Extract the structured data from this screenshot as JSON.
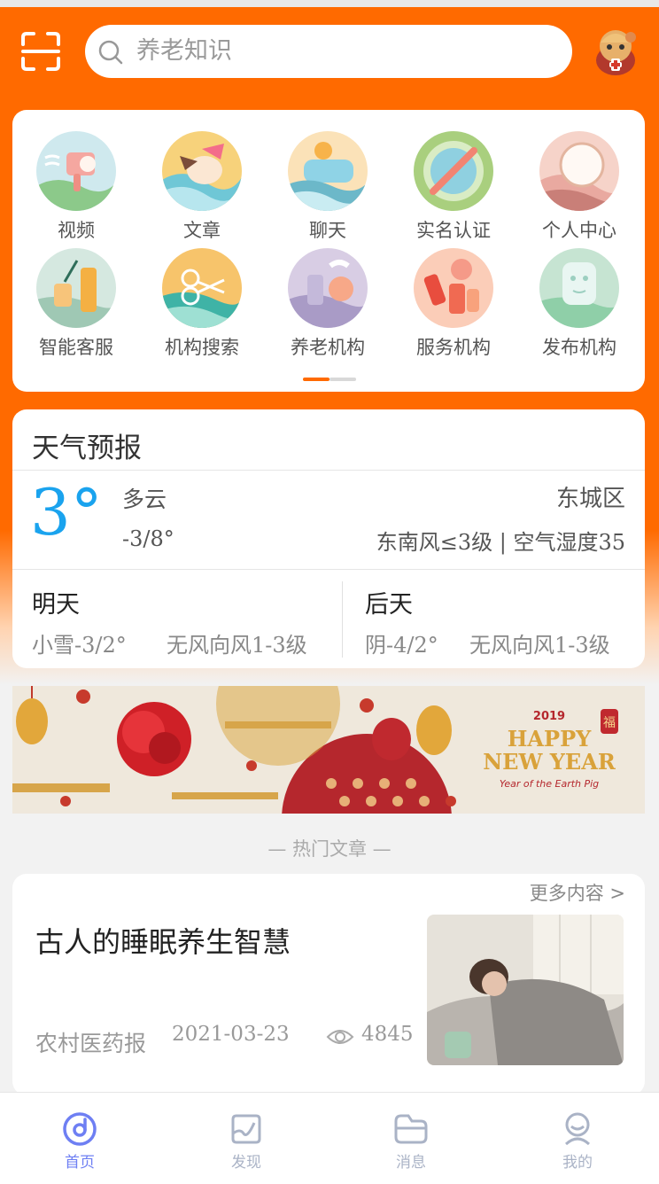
{
  "header": {
    "search_placeholder": "养老知识",
    "icons": {
      "scan": "scan-icon",
      "search": "search-icon",
      "avatar": "mascot-avatar"
    }
  },
  "grid": {
    "items": [
      {
        "label": "视频",
        "icon": "video-icon"
      },
      {
        "label": "文章",
        "icon": "article-icon"
      },
      {
        "label": "聊天",
        "icon": "chat-icon"
      },
      {
        "label": "实名认证",
        "icon": "verify-icon"
      },
      {
        "label": "个人中心",
        "icon": "profile-icon"
      },
      {
        "label": "智能客服",
        "icon": "service-bot-icon"
      },
      {
        "label": "机构搜索",
        "icon": "institution-search-icon"
      },
      {
        "label": "养老机构",
        "icon": "elderly-institution-icon"
      },
      {
        "label": "服务机构",
        "icon": "service-institution-icon"
      },
      {
        "label": "发布机构",
        "icon": "publish-institution-icon"
      }
    ],
    "page_index": 1,
    "page_count": 2
  },
  "weather": {
    "title": "天气预报",
    "temp": "3°",
    "condition": "多云",
    "range": "-3/8°",
    "district": "东城区",
    "wind_humidity": "东南风≤3级 | 空气湿度35",
    "tomorrow": {
      "title": "明天",
      "condition": "小雪-3/2°",
      "wind": "无风向风1-3级"
    },
    "day_after": {
      "title": "后天",
      "condition": "阴-4/2°",
      "wind": "无风向风1-3级"
    }
  },
  "banner": {
    "year": "2019",
    "line1": "HAPPY",
    "line2": "NEW YEAR",
    "subtitle": "Year of the Earth Pig",
    "fu": "福"
  },
  "hot": {
    "section_title": "— 热门文章 —",
    "more_label": "更多内容 >",
    "article": {
      "title": "古人的睡眠养生智慧",
      "source": "农村医药报",
      "date": "2021-03-23",
      "views": "4845"
    }
  },
  "tabbar": {
    "tabs": [
      {
        "label": "首页",
        "icon": "home-icon",
        "active": true
      },
      {
        "label": "发现",
        "icon": "discover-icon",
        "active": false
      },
      {
        "label": "消息",
        "icon": "message-icon",
        "active": false
      },
      {
        "label": "我的",
        "icon": "mine-icon",
        "active": false
      }
    ]
  },
  "colors": {
    "brand": "#ff6a00",
    "temp": "#1aa3ee",
    "tab_active": "#6e7ff3",
    "tab_inactive": "#aab3c6"
  }
}
